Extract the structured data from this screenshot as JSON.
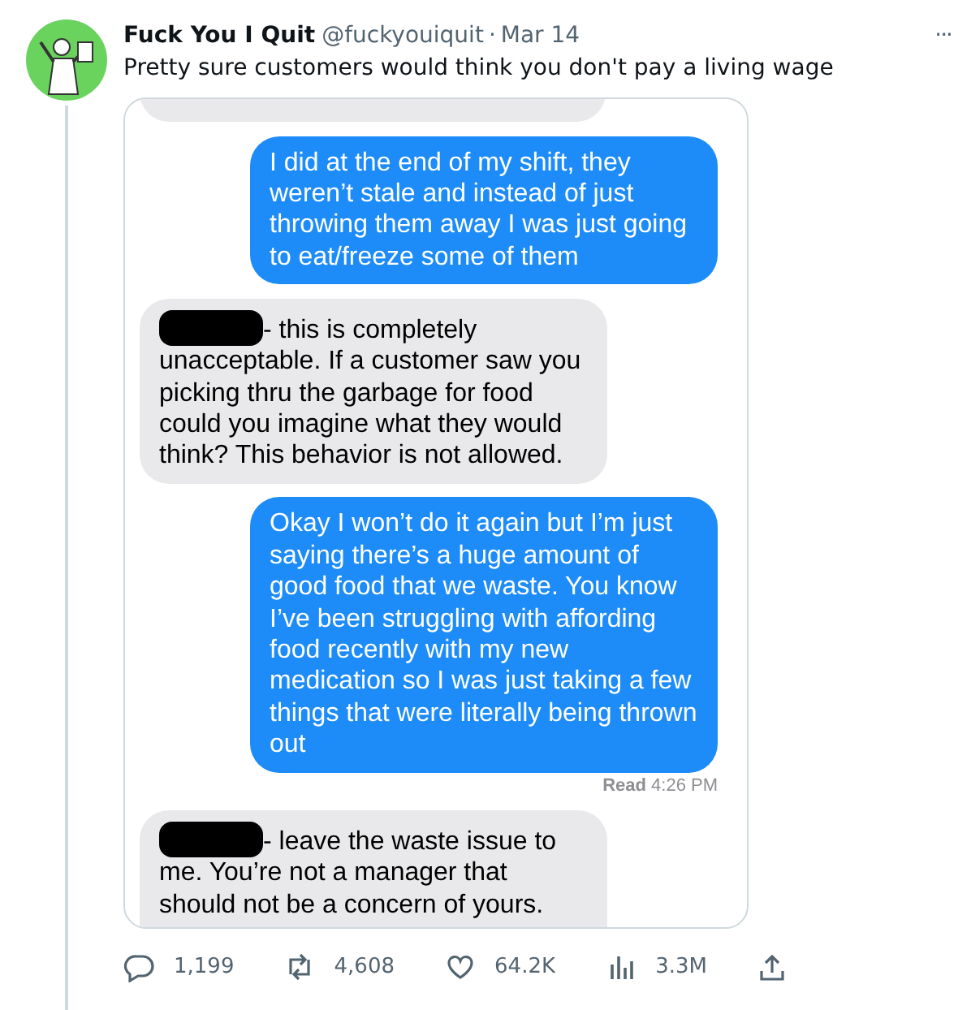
{
  "author": {
    "name": "Fuck You I Quit",
    "handle": "@fuckyouiquit",
    "separator": "·",
    "date": "Mar 14"
  },
  "more": "···",
  "text": "Pretty sure customers would think you don't pay a living wage",
  "messages": [
    {
      "kind": "fragment"
    },
    {
      "kind": "sent",
      "redacted": false,
      "text": "I did at the end of my shift, they weren’t stale and instead of just throwing them away I was just going to eat/freeze some of them"
    },
    {
      "kind": "received",
      "redacted": true,
      "text": "- this is completely unacceptable. If a customer saw you picking thru the garbage for food could you imagine what they would think? This behavior is not allowed."
    },
    {
      "kind": "sent",
      "redacted": false,
      "text": "Okay I won’t do it again but I’m just saying there’s a huge amount of good food that we waste. You know I’ve been struggling with affording food recently with my new medication so I was just taking a few things that were literally being thrown out"
    },
    {
      "kind": "receipt",
      "text": "**Read** 4:26 PM"
    },
    {
      "kind": "received",
      "redacted": true,
      "text": "- leave the waste issue to me. You’re not a manager that should not be a concern of yours."
    }
  ],
  "actions": [
    {
      "kind": "reply",
      "count": "1,199"
    },
    {
      "kind": "retweet",
      "count": "4,608"
    },
    {
      "kind": "like",
      "count": "64.2K"
    },
    {
      "kind": "views",
      "count": "3.3M"
    },
    {
      "kind": "share"
    }
  ]
}
